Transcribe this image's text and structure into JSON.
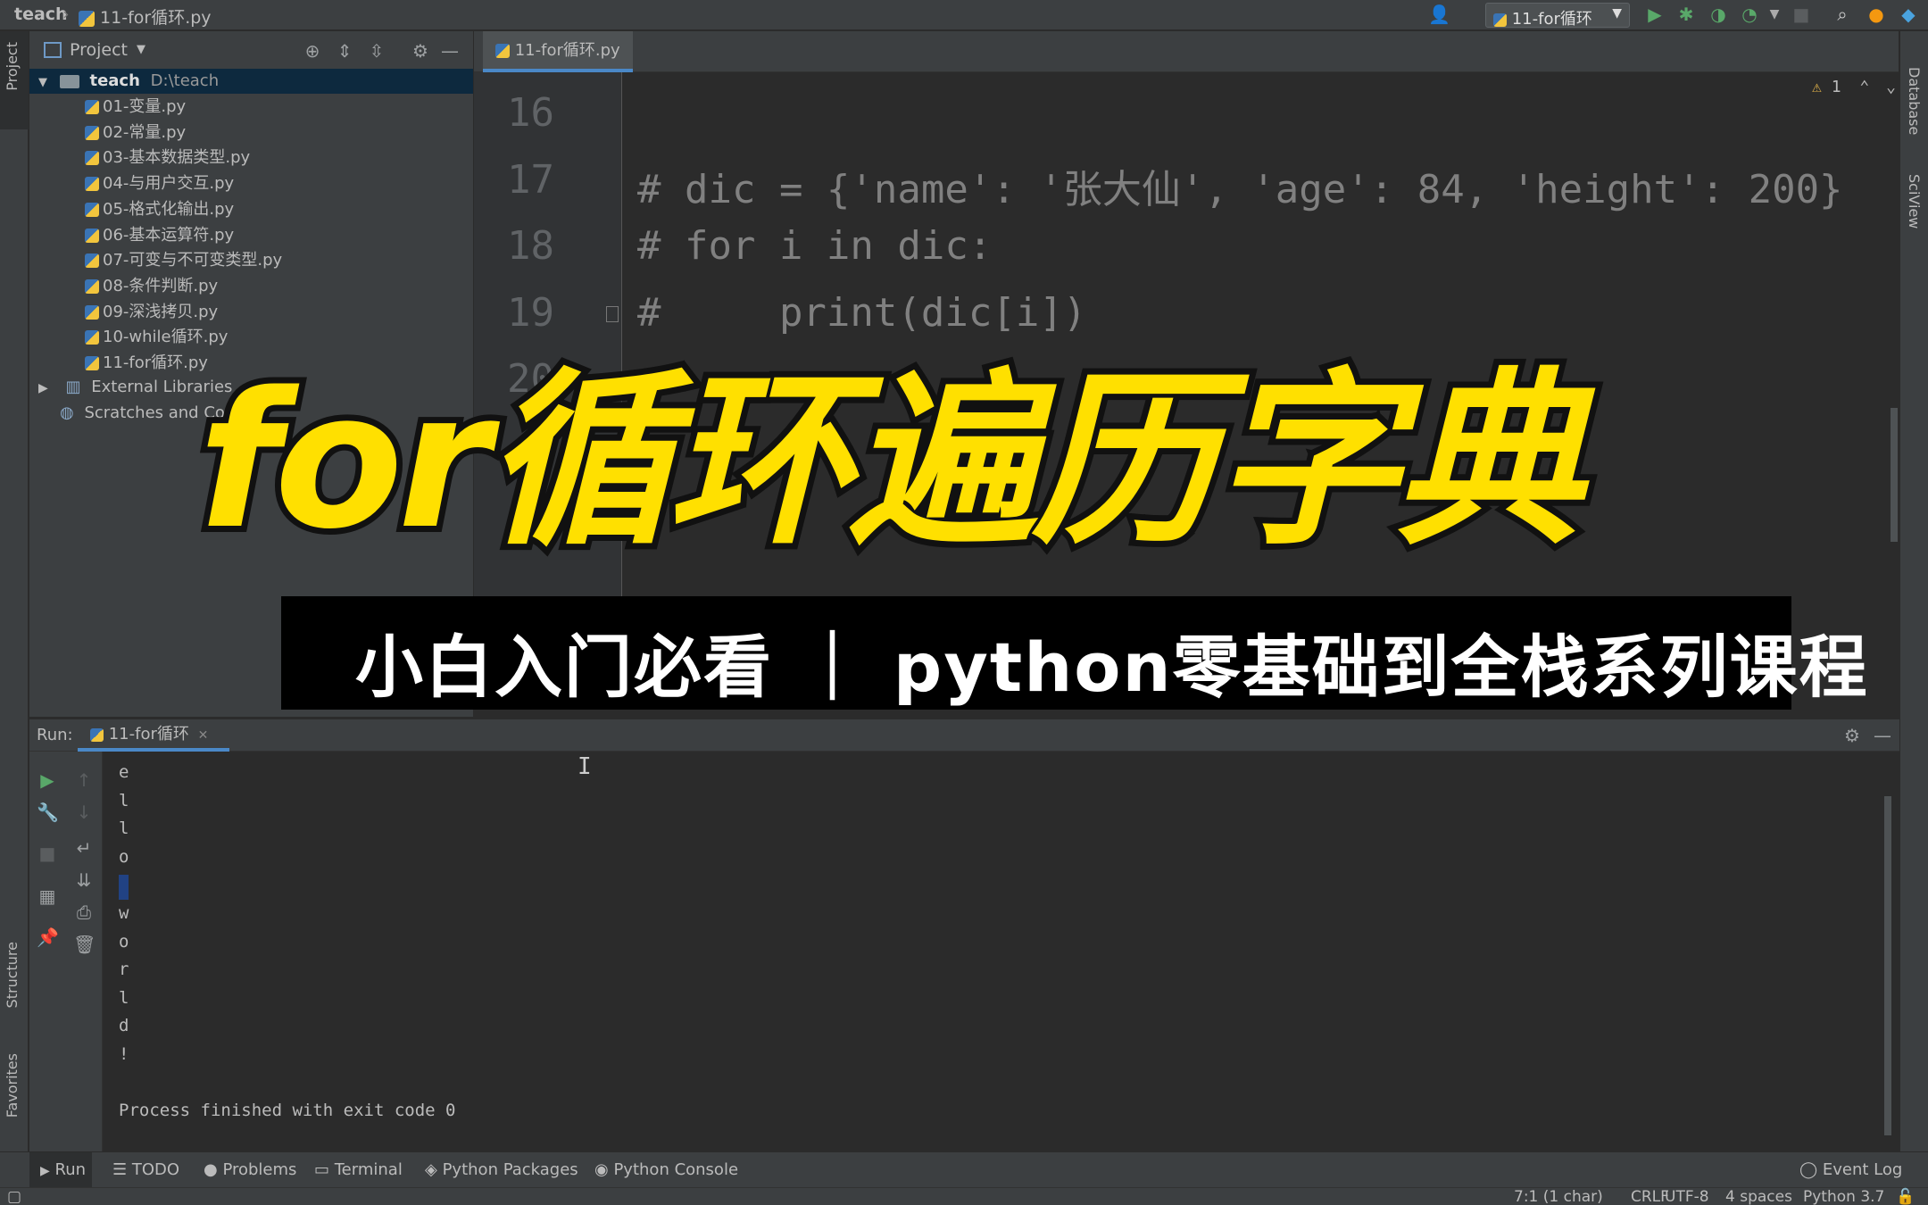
{
  "titlebar": {
    "project": "teach",
    "file": "11-for循环.py",
    "run_config": "11-for循环"
  },
  "left_strip": {
    "project_tab": "Project",
    "structure_tab": "Structure",
    "favorites_tab": "Favorites"
  },
  "right_strip": {
    "database_tab": "Database",
    "sciview_tab": "SciView"
  },
  "project_panel": {
    "title": "Project",
    "root_name": "teach",
    "root_path": "D:\\teach",
    "files": [
      "01-变量.py",
      "02-常量.py",
      "03-基本数据类型.py",
      "04-与用户交互.py",
      "05-格式化输出.py",
      "06-基本运算符.py",
      "07-可变与不可变类型.py",
      "08-条件判断.py",
      "09-深浅拷贝.py",
      "10-while循环.py",
      "11-for循环.py"
    ],
    "external_libraries": "External Libraries",
    "scratches": "Scratches and Cons"
  },
  "editor": {
    "tab": "11-for循环.py",
    "warnings": "1",
    "line_numbers": [
      "16",
      "17",
      "18",
      "19",
      "20"
    ],
    "lines": [
      "",
      "# dic = {'name': '张大仙', 'age': 84, 'height': 200}",
      "# for i in dic:",
      "#     print(dic[i])",
      ""
    ]
  },
  "run_panel": {
    "label": "Run:",
    "tab": "11-for循环",
    "output_chars": [
      "e",
      "l",
      "l",
      "o",
      " ",
      "w",
      "o",
      "r",
      "l",
      "d",
      "!"
    ],
    "finished": "Process finished with exit code 0"
  },
  "bottom_tabs": {
    "run": "Run",
    "todo": "TODO",
    "problems": "Problems",
    "terminal": "Terminal",
    "python_packages": "Python Packages",
    "python_console": "Python Console",
    "event_log": "Event Log"
  },
  "status": {
    "position": "7:1 (1 char)",
    "line_sep": "CRLF",
    "encoding": "UTF-8",
    "indent": "4 spaces",
    "interpreter": "Python 3.7"
  },
  "overlay": {
    "title": "for循环遍历字典",
    "subtitle": "小白入门必看 ｜ python零基础到全栈系列课程"
  },
  "colors": {
    "title_yellow": "#ffe000",
    "ide_bg": "#2b2b2b",
    "panel_bg": "#3c3f41"
  }
}
